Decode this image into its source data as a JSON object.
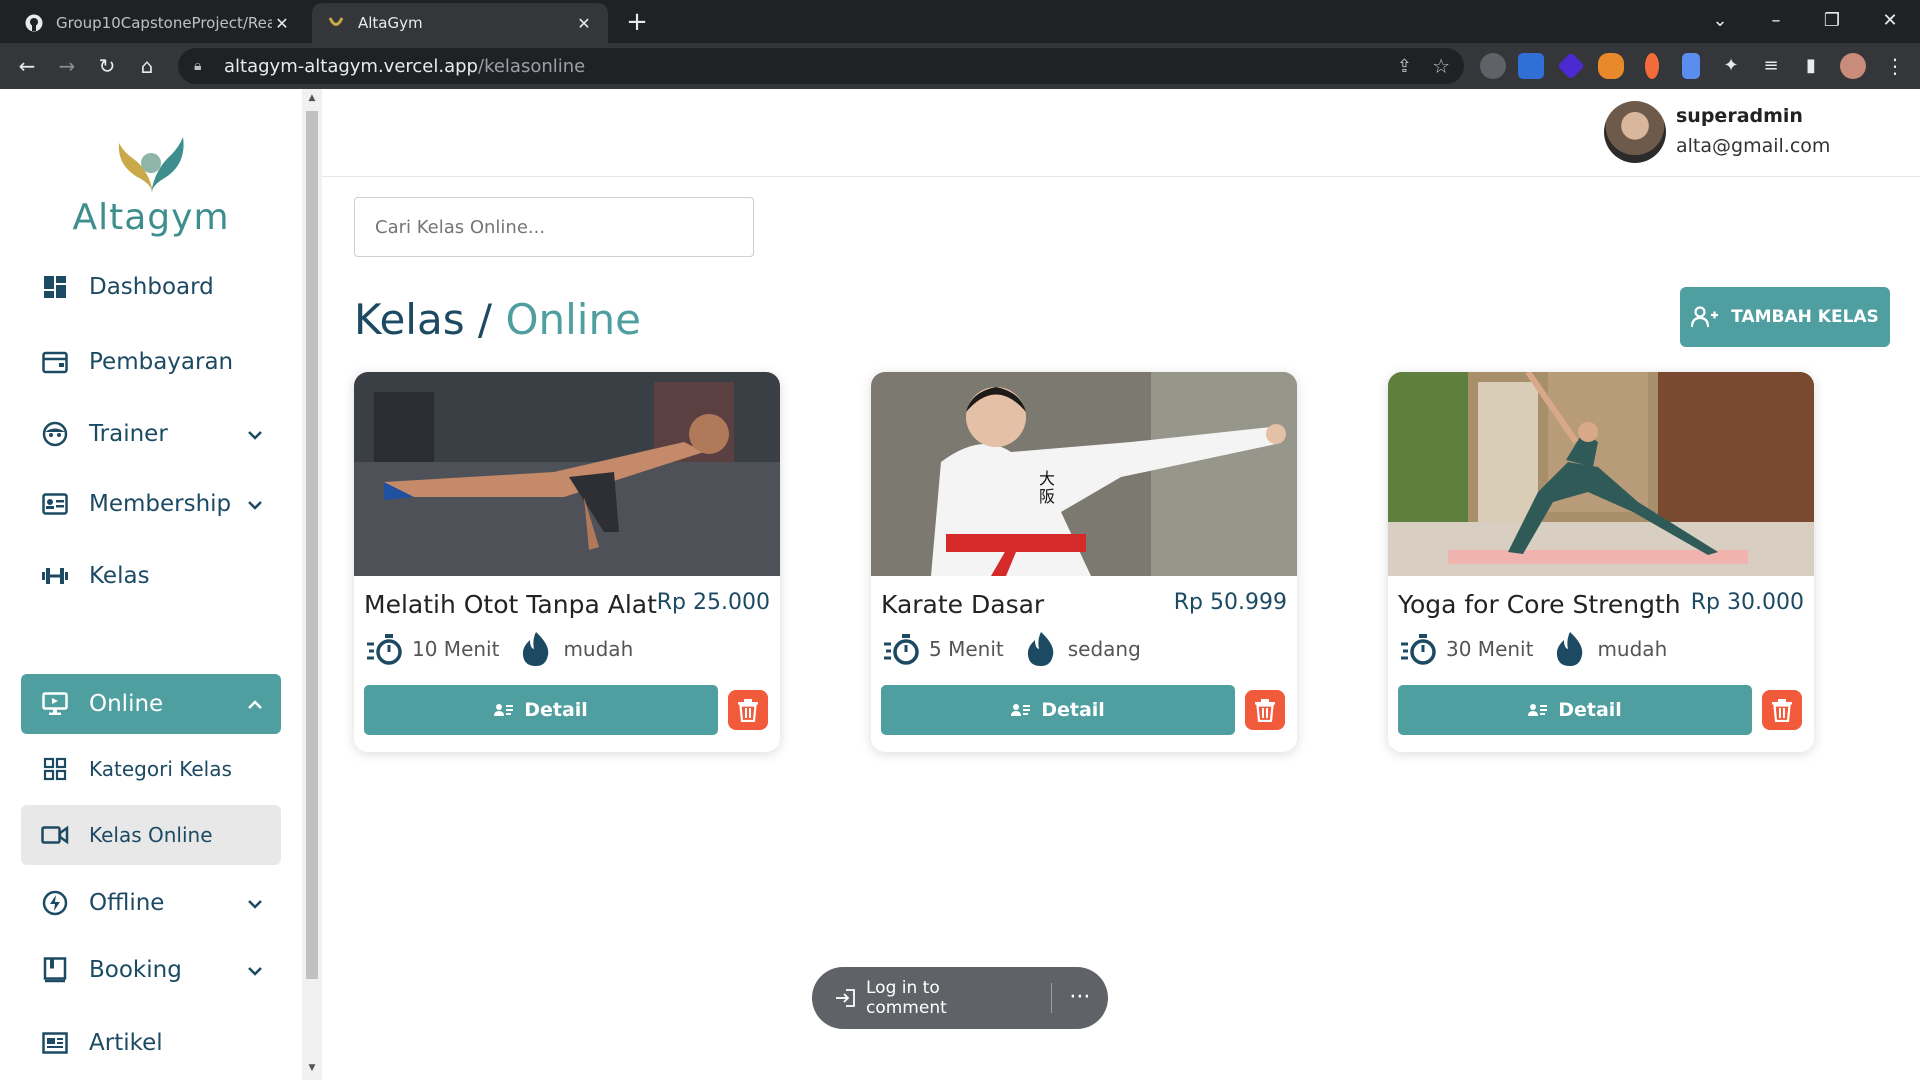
{
  "browser": {
    "tabs": [
      {
        "title": "Group10CapstoneProject/React",
        "active": false
      },
      {
        "title": "AltaGym",
        "active": true
      }
    ],
    "url_host": "altagym-altagym.vercel.app",
    "url_path": "/kelasonline"
  },
  "brand": {
    "name": "Altagym",
    "accent": "#4f9ea0",
    "navy": "#1c4a63",
    "danger": "#f15a3b"
  },
  "sidebar": {
    "items": [
      {
        "label": "Dashboard",
        "icon": "dashboard-icon"
      },
      {
        "label": "Pembayaran",
        "icon": "wallet-icon"
      },
      {
        "label": "Trainer",
        "icon": "face-icon"
      },
      {
        "label": "Membership",
        "icon": "id-card-icon"
      },
      {
        "label": "Kelas",
        "icon": "dumbbell-icon"
      },
      {
        "label": "Online",
        "icon": "monitor-icon"
      },
      {
        "label": "Kategori Kelas",
        "icon": "grid-icon"
      },
      {
        "label": "Kelas Online",
        "icon": "video-icon"
      },
      {
        "label": "Offline",
        "icon": "bolt-icon"
      },
      {
        "label": "Booking",
        "icon": "book-icon"
      },
      {
        "label": "Artikel",
        "icon": "article-icon"
      }
    ]
  },
  "user": {
    "name": "superadmin",
    "email": "alta@gmail.com"
  },
  "search": {
    "placeholder": "Cari Kelas Online..."
  },
  "page": {
    "title_main": "Kelas",
    "title_sep": " / ",
    "title_accent": "Online",
    "add_button": "TAMBAH KELAS"
  },
  "cards": [
    {
      "title": "Melatih Otot Tanpa Alat",
      "price": "Rp 25.000",
      "duration": "10 Menit",
      "level": "mudah",
      "detail": "Detail"
    },
    {
      "title": "Karate Dasar",
      "price": "Rp 50.999",
      "duration": "5 Menit",
      "level": "sedang",
      "detail": "Detail"
    },
    {
      "title": "Yoga for Core Strength",
      "price": "Rp 30.000",
      "duration": "30 Menit",
      "level": "mudah",
      "detail": "Detail"
    }
  ],
  "comment": {
    "label": "Log in to comment",
    "more": "···"
  }
}
